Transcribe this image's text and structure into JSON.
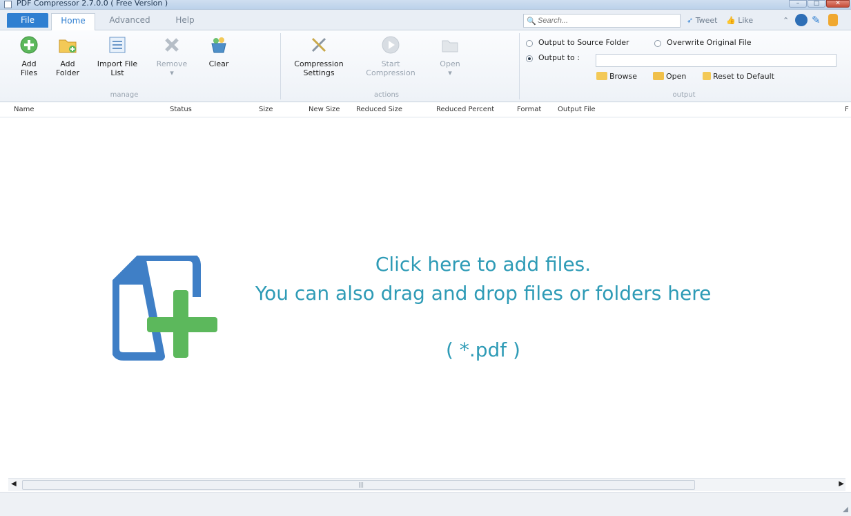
{
  "window": {
    "title": "PDF Compressor 2.7.0.0 ( Free Version )",
    "controls": [
      "minimize",
      "maximize",
      "close"
    ]
  },
  "tabs": {
    "file": "File",
    "home": "Home",
    "advanced": "Advanced",
    "help": "Help"
  },
  "search": {
    "placeholder": "Search..."
  },
  "social": {
    "tweet": "Tweet",
    "like": "Like"
  },
  "ribbon": {
    "manage": {
      "label": "manage",
      "add_files": "Add Files",
      "add_folder": "Add Folder",
      "import_list": "Import File List",
      "remove": "Remove",
      "clear": "Clear"
    },
    "actions": {
      "label": "actions",
      "compression_settings": "Compression Settings",
      "start_compression": "Start Compression",
      "open": "Open"
    },
    "output": {
      "label": "output",
      "to_source": "Output to Source Folder",
      "overwrite": "Overwrite Original File",
      "output_to": "Output to :",
      "output_value": "",
      "browse": "Browse",
      "open": "Open",
      "reset": "Reset to Default",
      "selected": "output_to"
    }
  },
  "table": {
    "columns": [
      "Name",
      "Status",
      "Size",
      "New Size",
      "Reduced Size",
      "Reduced Percent",
      "Format",
      "Output File",
      "F"
    ]
  },
  "drop": {
    "line1": "Click here to add files.",
    "line2": "You can also drag and drop files or folders here",
    "ext": "( *.pdf )"
  },
  "colors": {
    "accent": "#2f7fd1",
    "drop_text": "#2e9bb6",
    "plus_green": "#5cb85c",
    "doc_blue": "#3f7fc6"
  }
}
